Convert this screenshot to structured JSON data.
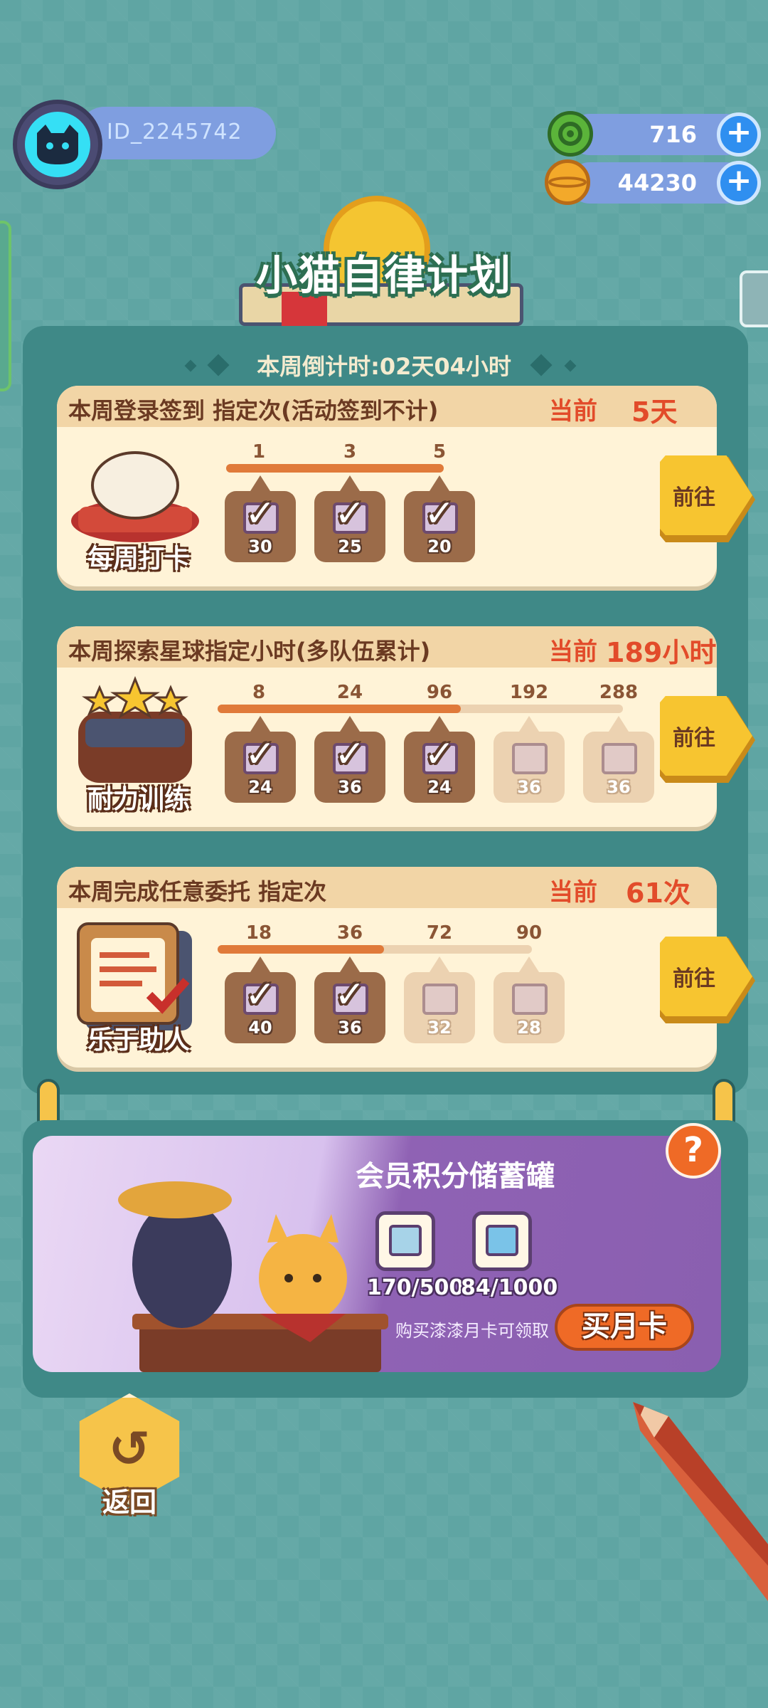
{
  "player": {
    "id": "ID_2245742"
  },
  "resources": {
    "gems": "716",
    "coins": "44230"
  },
  "title": "小猫自律计划",
  "countdown": "本周倒计时:02天04小时",
  "tasks": [
    {
      "title": "本周登录签到 指定次(活动签到不计)",
      "current_label": "当前",
      "current_value": "5天",
      "art_label": "每周打卡",
      "progress": 1.0,
      "milestones": [
        "1",
        "3",
        "5"
      ],
      "rewards": [
        {
          "count": "30",
          "claimed": true
        },
        {
          "count": "25",
          "claimed": true
        },
        {
          "count": "20",
          "claimed": true
        }
      ],
      "go_label": "前往"
    },
    {
      "title": "本周探索星球指定小时(多队伍累计)",
      "current_label": "当前",
      "current_value": "189小时",
      "art_label": "耐力训练",
      "progress": 0.6,
      "milestones": [
        "8",
        "24",
        "96",
        "192",
        "288"
      ],
      "rewards": [
        {
          "count": "24",
          "claimed": true
        },
        {
          "count": "36",
          "claimed": true
        },
        {
          "count": "24",
          "claimed": true
        },
        {
          "count": "36",
          "claimed": false
        },
        {
          "count": "36",
          "claimed": false
        }
      ],
      "go_label": "前往"
    },
    {
      "title": "本周完成任意委托 指定次",
      "current_label": "当前",
      "current_value": "61次",
      "art_label": "乐于助人",
      "progress": 0.53,
      "milestones": [
        "18",
        "36",
        "72",
        "90"
      ],
      "rewards": [
        {
          "count": "40",
          "claimed": true
        },
        {
          "count": "36",
          "claimed": true
        },
        {
          "count": "32",
          "claimed": false
        },
        {
          "count": "28",
          "claimed": false
        }
      ],
      "go_label": "前往"
    }
  ],
  "member": {
    "title": "会员积分储蓄罐",
    "rewards": [
      "170/500",
      "84/1000"
    ],
    "note": "购买漆漆月卡可领取",
    "buy_label": "买月卡",
    "help_label": "?"
  },
  "back_label": "返回",
  "icons": {
    "gem": "green-gem-icon",
    "coin": "gold-planet-coin-icon",
    "plus": "plus-icon",
    "check": "checkmark-icon",
    "back": "undo-arrow-icon"
  }
}
